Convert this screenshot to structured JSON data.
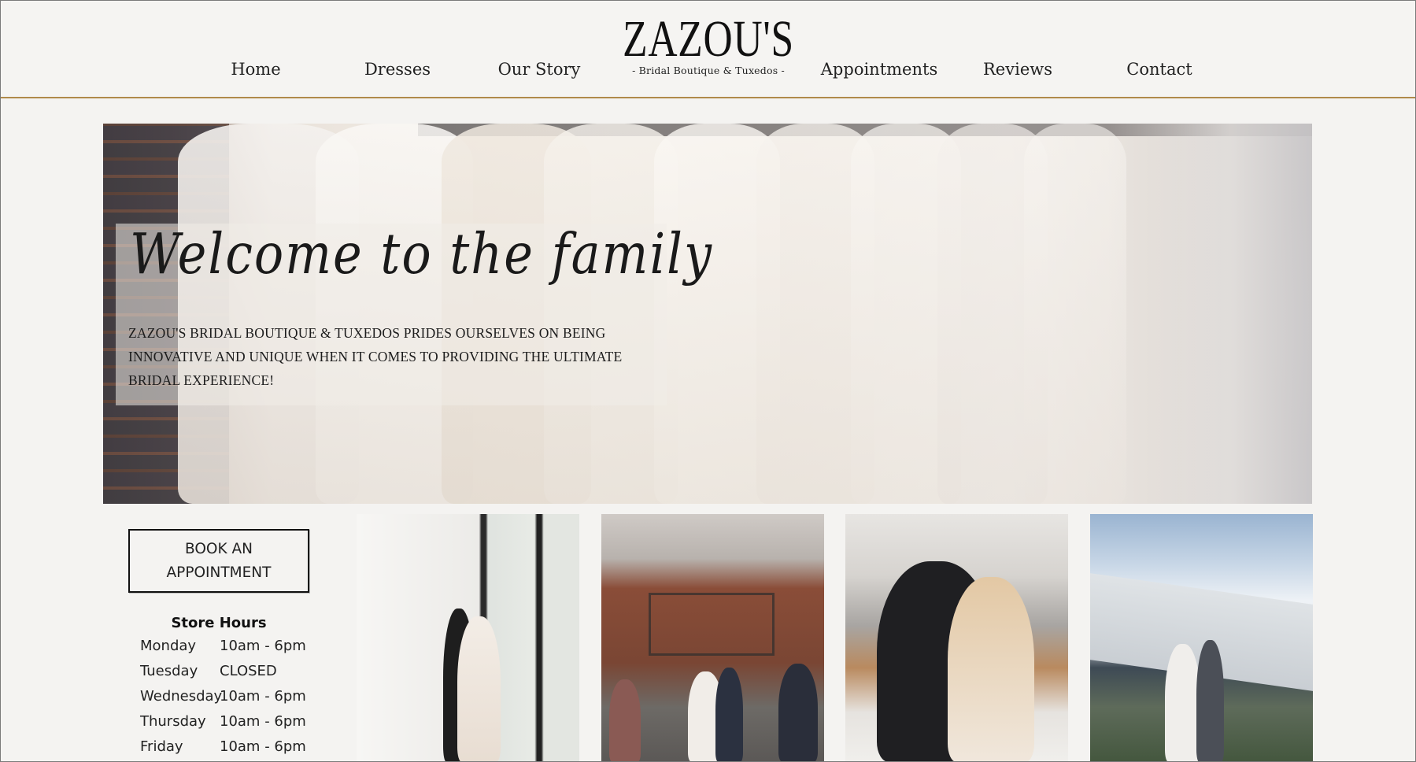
{
  "nav": {
    "home": "Home",
    "dresses": "Dresses",
    "our_story": "Our Story",
    "appointments": "Appointments",
    "reviews": "Reviews",
    "contact": "Contact"
  },
  "logo": {
    "name": "ZAZOU'S",
    "tagline": "- Bridal Boutique & Tuxedos -"
  },
  "hero": {
    "title": "Welcome to the family",
    "text": "ZAZOU'S BRIDAL BOUTIQUE & TUXEDOS PRIDES OURSELVES ON BEING INNOVATIVE AND UNIQUE WHEN IT COMES TO PROVIDING THE ULTIMATE BRIDAL EXPERIENCE!"
  },
  "booking": {
    "button_line1": "BOOK AN",
    "button_line2": "APPOINTMENT"
  },
  "store_hours": {
    "title": "Store Hours",
    "rows": [
      {
        "day": "Monday",
        "time": "10am - 6pm"
      },
      {
        "day": "Tuesday",
        "time": "CLOSED"
      },
      {
        "day": "Wednesday",
        "time": "10am - 6pm"
      },
      {
        "day": "Thursday",
        "time": "10am - 6pm"
      },
      {
        "day": "Friday",
        "time": "10am - 6pm"
      }
    ]
  },
  "colors": {
    "background": "#f4f3f1",
    "accent_line": "#b08a4a",
    "text": "#1c1c1c"
  }
}
